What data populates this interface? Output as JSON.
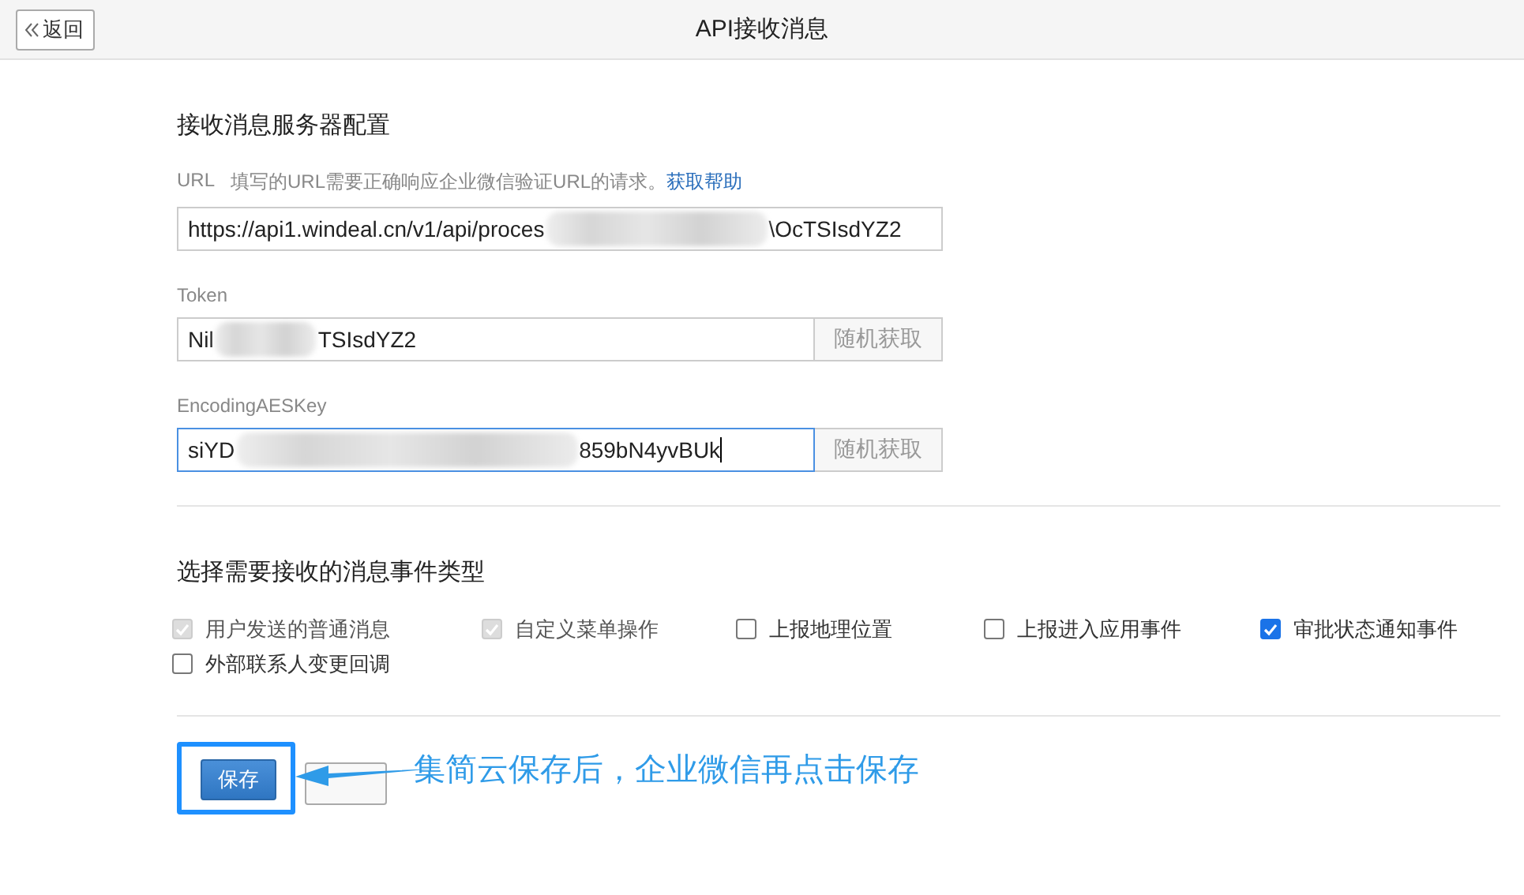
{
  "header": {
    "back_button": "返回",
    "title": "API接收消息"
  },
  "server_config": {
    "title": "接收消息服务器配置",
    "fields": [
      {
        "kind": "url",
        "label": "URL",
        "hint": "填写的URL需要正确响应企业微信验证URL的请求。",
        "help_link": "获取帮助",
        "value_parts": [
          "https://api1.windeal.cn/v1/api/proces",
          "\\OcTSIsdYZ2"
        ],
        "focused": false
      },
      {
        "kind": "secret",
        "label": "Token",
        "value_parts": [
          "Nil",
          "TSIsdYZ2"
        ],
        "button": "随机获取",
        "focused": false
      },
      {
        "kind": "secret",
        "label": "EncodingAESKey",
        "value_parts": [
          "siYD",
          "859bN4yvBUk"
        ],
        "button": "随机获取",
        "focused": true
      }
    ]
  },
  "events": {
    "title": "选择需要接收的消息事件类型",
    "items": [
      {
        "label": "用户发送的普通消息",
        "checked": true,
        "disabled": true
      },
      {
        "label": "自定义菜单操作",
        "checked": true,
        "disabled": true
      },
      {
        "label": "上报地理位置",
        "checked": false,
        "disabled": false
      },
      {
        "label": "上报进入应用事件",
        "checked": false,
        "disabled": false
      },
      {
        "label": "审批状态通知事件",
        "checked": true,
        "disabled": false
      },
      {
        "label": "外部联系人变更回调",
        "checked": false,
        "disabled": false
      }
    ]
  },
  "footer": {
    "save_button": "保存",
    "annotation": "集简云保存后，企业微信再点击保存"
  }
}
